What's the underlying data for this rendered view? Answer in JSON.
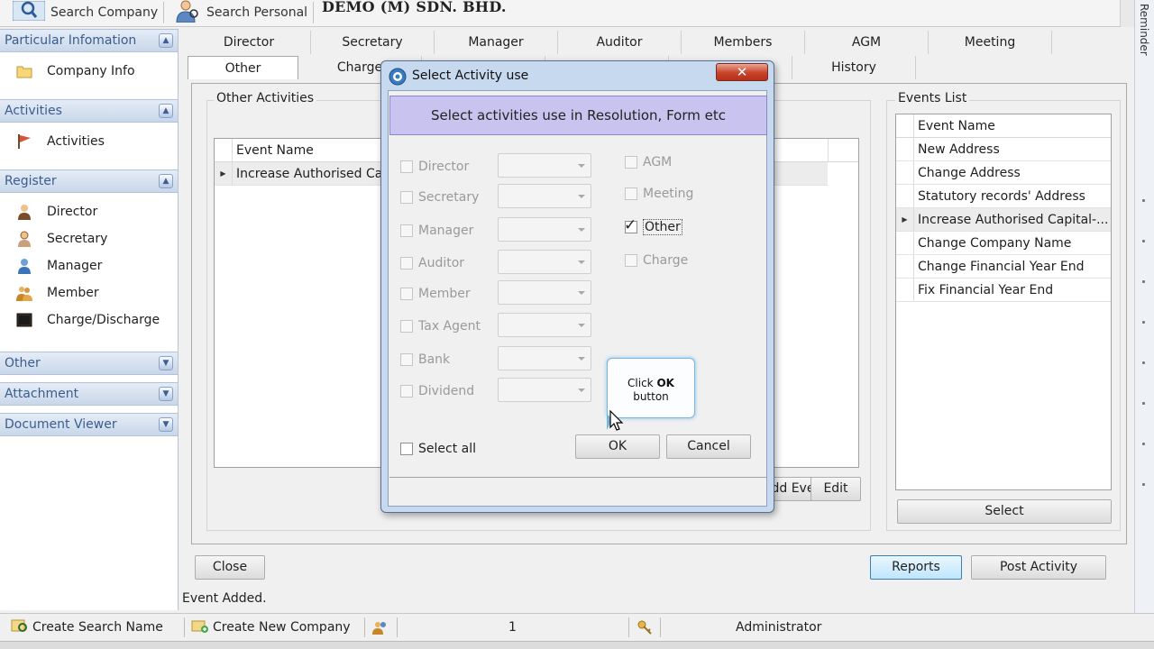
{
  "toolbar": {
    "search_company": "Search Company",
    "search_personal": "Search Personal",
    "company_name": "DEMO (M) SDN. BHD."
  },
  "reminder_label": "Reminder",
  "sidebar": {
    "sections": [
      {
        "title": "Particular Infomation",
        "items": [
          {
            "label": "Company Info",
            "icon": "folder-icon"
          }
        ]
      },
      {
        "title": "Activities",
        "items": [
          {
            "label": "Activities",
            "icon": "flag-icon"
          }
        ]
      },
      {
        "title": "Register",
        "items": [
          {
            "label": "Director",
            "icon": "director-icon"
          },
          {
            "label": "Secretary",
            "icon": "secretary-icon"
          },
          {
            "label": "Manager",
            "icon": "manager-icon"
          },
          {
            "label": "Member",
            "icon": "member-icon"
          },
          {
            "label": "Charge/Discharge",
            "icon": "charge-icon"
          }
        ]
      },
      {
        "title": "Other",
        "items": []
      },
      {
        "title": "Attachment",
        "items": []
      },
      {
        "title": "Document Viewer",
        "items": []
      }
    ]
  },
  "tabs": {
    "row1": [
      "Director",
      "Secretary",
      "Manager",
      "Auditor",
      "Members",
      "AGM",
      "Meeting"
    ],
    "row2": [
      "Other",
      "Charge",
      "",
      "",
      "",
      "History"
    ],
    "active": "Other"
  },
  "other_activities": {
    "title": "Other Activities",
    "column": "Event Name",
    "rows": [
      "Increase Authorised Capital"
    ]
  },
  "events_list": {
    "title": "Events List",
    "column": "Event Name",
    "rows": [
      "New Address",
      "Change Address",
      "Statutory records' Address",
      "Increase Authorised Capital-...",
      "Change Company Name",
      "Change Financial Year End",
      "Fix Financial Year End"
    ],
    "selected_index": 3,
    "select_button": "Select"
  },
  "buttons": {
    "add_event": "Add Event",
    "edit": "Edit",
    "close": "Close",
    "reports": "Reports",
    "post_activity": "Post Activity"
  },
  "status_message": "Event Added.",
  "statusbar": {
    "create_search_name": "Create Search Name",
    "create_new_company": "Create New Company",
    "count": "1",
    "user": "Administrator"
  },
  "dialog": {
    "title": "Select Activity use",
    "banner": "Select activities use in Resolution, Form etc",
    "left_options": [
      {
        "label": "Director",
        "checked": false
      },
      {
        "label": "Secretary",
        "checked": false
      },
      {
        "label": "Manager",
        "checked": false
      },
      {
        "label": "Auditor",
        "checked": false
      },
      {
        "label": "Member",
        "checked": false
      },
      {
        "label": "Tax Agent",
        "checked": false
      },
      {
        "label": "Bank",
        "checked": false
      },
      {
        "label": "Dividend",
        "checked": false
      }
    ],
    "right_options": [
      {
        "label": "AGM",
        "checked": false
      },
      {
        "label": "Meeting",
        "checked": false
      },
      {
        "label": "Other",
        "checked": true
      },
      {
        "label": "Charge",
        "checked": false
      }
    ],
    "select_all": "Select all",
    "ok": "OK",
    "cancel": "Cancel",
    "close_glyph": "✕"
  },
  "callout": {
    "prefix": "Click ",
    "bold": "OK",
    "suffix": "button"
  }
}
